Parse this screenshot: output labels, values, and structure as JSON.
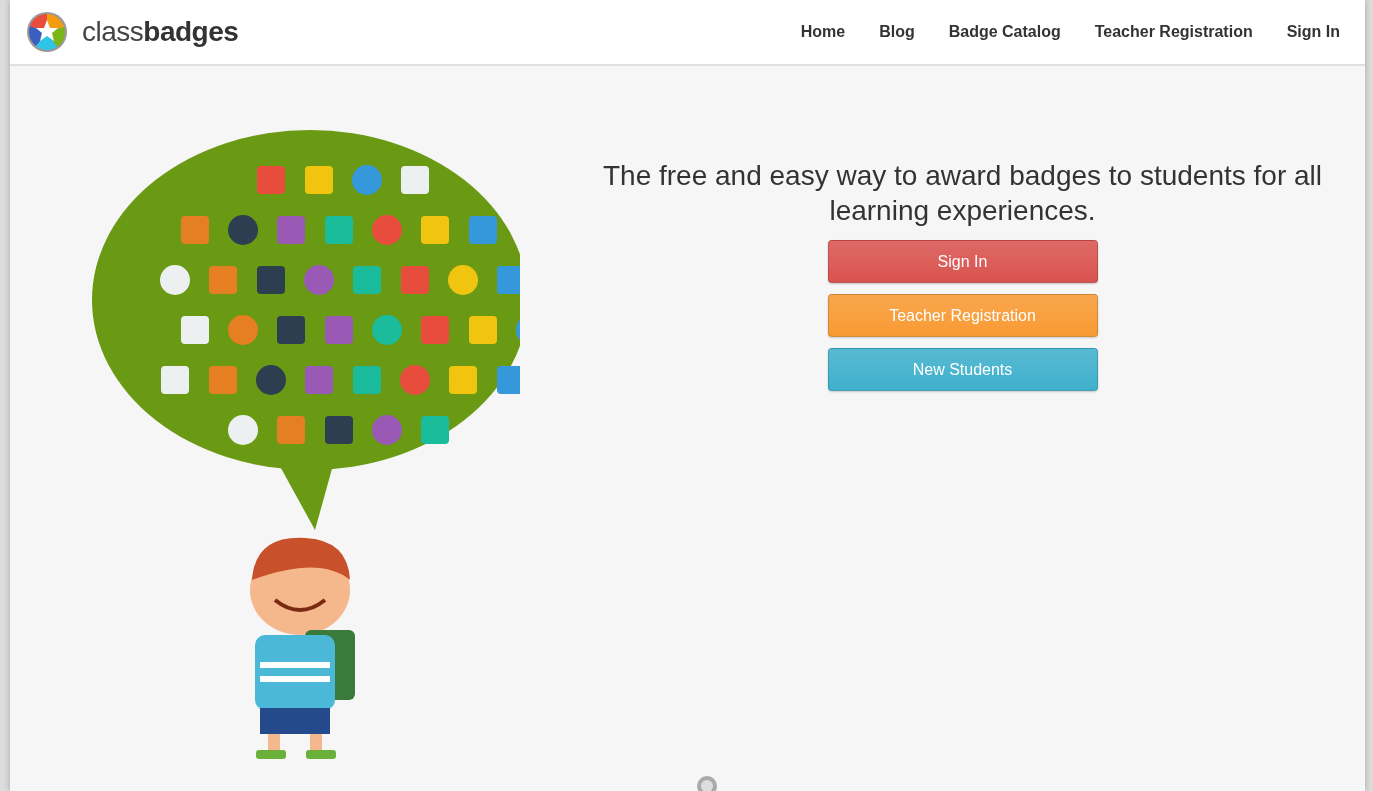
{
  "logo": {
    "text": "class**badges**"
  },
  "nav": [
    {
      "label": "Home"
    },
    {
      "label": "Blog"
    },
    {
      "label": "Badge Catalog"
    },
    {
      "label": "Teacher Registration"
    },
    {
      "label": "Sign In"
    }
  ],
  "hero": {
    "tagline": "The free and easy way to award badges to students for all learning experiences.",
    "buttons": [
      {
        "label": "Sign In",
        "color": "#d9534f"
      },
      {
        "label": "Teacher Registration",
        "color": "#f89a33"
      },
      {
        "label": "New Students",
        "color": "#3fb0cc"
      }
    ]
  }
}
